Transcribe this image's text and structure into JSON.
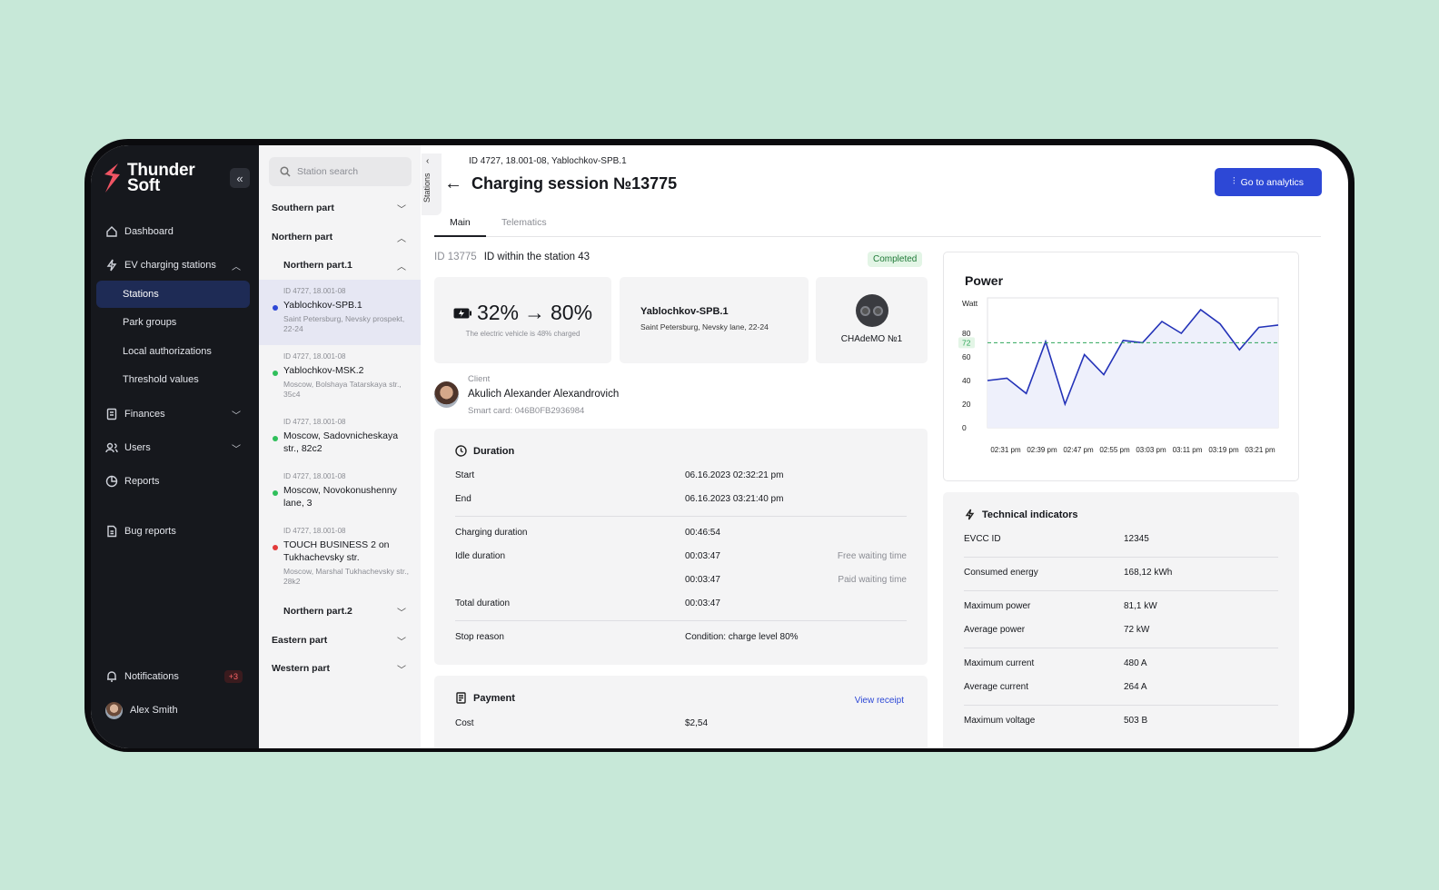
{
  "app": {
    "brand_line1": "Thunder",
    "brand_line2": "Soft"
  },
  "sidebar": {
    "items": [
      {
        "label": "Dashboard",
        "icon": "home-icon"
      },
      {
        "label": "EV charging stations",
        "icon": "bolt-icon"
      },
      {
        "label": "Stations"
      },
      {
        "label": "Park groups"
      },
      {
        "label": "Local authorizations"
      },
      {
        "label": "Threshold values"
      },
      {
        "label": "Finances",
        "icon": "document-icon"
      },
      {
        "label": "Users",
        "icon": "users-icon"
      },
      {
        "label": "Reports",
        "icon": "pie-icon"
      },
      {
        "label": "Bug reports",
        "icon": "file-icon"
      }
    ],
    "notifications": {
      "label": "Notifications",
      "badge": "+3"
    },
    "user": {
      "name": "Alex Smith"
    }
  },
  "stations_panel": {
    "tab_label": "Stations",
    "search_placeholder": "Station search",
    "groups": {
      "southern": "Southern part",
      "northern": "Northern part",
      "northern1": "Northern part.1",
      "northern2": "Northern part.2",
      "eastern": "Eastern part",
      "western": "Western part"
    },
    "stations": [
      {
        "id": "ID 4727, 18.001-08",
        "name": "Yablochkov-SPB.1",
        "address": "Saint Petersburg, Nevsky prospekt, 22-24",
        "status_color": "#2d48d6"
      },
      {
        "id": "ID 4727, 18.001-08",
        "name": "Yablochkov-MSK.2",
        "address": "Moscow, Bolshaya Tatarskaya str., 35c4",
        "status_color": "#2fbf5b"
      },
      {
        "id": "ID 4727, 18.001-08",
        "name": "Moscow, Sadovnicheskaya str., 82c2",
        "address": "",
        "status_color": "#2fbf5b"
      },
      {
        "id": "ID 4727, 18.001-08",
        "name": "Moscow, Novokonushenny lane, 3",
        "address": "",
        "status_color": "#2fbf5b"
      },
      {
        "id": "ID 4727, 18.001-08",
        "name": "TOUCH BUSINESS 2 on Tukhachevsky str.",
        "address": "Moscow, Marshal Tukhachevsky str., 28k2",
        "status_color": "#e23a3a"
      }
    ]
  },
  "header": {
    "breadcrumb": "ID 4727, 18.001-08, Yablochkov-SPB.1",
    "title": "Charging session №13775",
    "analytics_button": "Go to analytics"
  },
  "tabs": [
    "Main",
    "Telematics"
  ],
  "session": {
    "id": "ID 13775",
    "station_id_text": "ID within the station 43",
    "status": "Completed",
    "charge_from": "32%",
    "charge_to": "80%",
    "charge_note": "The electric vehicle is 48% charged",
    "station_name": "Yablochkov-SPB.1",
    "station_address": "Saint Petersburg, Nevsky lane, 22-24",
    "connector": "CHAdeMO №1"
  },
  "client": {
    "label": "Client",
    "name": "Akulich Alexander Alexandrovich",
    "card": "Smart card: 046B0FB2936984"
  },
  "duration": {
    "title": "Duration",
    "start_label": "Start",
    "start": "06.16.2023 02:32:21 pm",
    "end_label": "End",
    "end": "06.16.2023 03:21:40 pm",
    "charging_label": "Charging duration",
    "charging": "00:46:54",
    "idle_label": "Idle duration",
    "idle_free": "00:03:47",
    "free_label": "Free waiting time",
    "idle_paid": "00:03:47",
    "paid_label": "Paid waiting time",
    "total_label": "Total duration",
    "total": "00:03:47",
    "stop_label": "Stop reason",
    "stop": "Condition: charge level 80%"
  },
  "payment": {
    "title": "Payment",
    "receipt": "View receipt",
    "cost_label": "Cost",
    "cost": "$2,54"
  },
  "technical": {
    "title": "Technical indicators",
    "rows": [
      {
        "label": "EVCC ID",
        "value": "12345"
      },
      {
        "label": "Consumed energy",
        "value": "168,12  kWh"
      },
      {
        "label": "Maximum power",
        "value": "81,1 kW"
      },
      {
        "label": "Average power",
        "value": "72 kW"
      },
      {
        "label": "Maximum current",
        "value": "480 A"
      },
      {
        "label": "Average current",
        "value": "264 A"
      },
      {
        "label": "Maximum voltage",
        "value": "503 B"
      }
    ]
  },
  "chart_data": {
    "type": "line",
    "title": "Power",
    "ylabel": "Watt",
    "ylim": [
      0,
      110
    ],
    "yticks": [
      0,
      20,
      40,
      60,
      80
    ],
    "reference_line": {
      "value": 72,
      "label": "72",
      "color": "#2fa55a"
    },
    "xtick_labels": [
      "02:31 pm",
      "02:39 pm",
      "02:47 pm",
      "02:55 pm",
      "03:03 pm",
      "03:11 pm",
      "03:19 pm",
      "03:21 pm"
    ],
    "x": [
      0,
      1,
      2,
      3,
      4,
      5,
      6,
      7,
      8,
      9,
      10,
      11,
      12,
      13,
      14,
      15,
      16
    ],
    "series": [
      {
        "color": "#2332b8",
        "values": [
          40,
          42,
          29,
          73,
          20,
          62,
          45,
          74,
          72,
          90,
          80,
          100,
          88,
          66,
          85,
          87
        ]
      }
    ]
  }
}
